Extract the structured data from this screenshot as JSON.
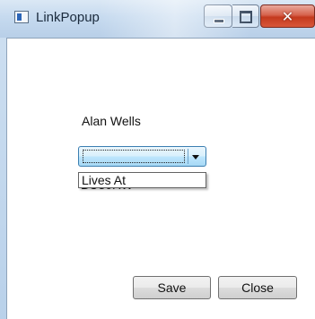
{
  "window": {
    "title": "LinkPopup",
    "icon": "app-window-icon",
    "controls": {
      "minimize_icon": "minimize-icon",
      "maximize_icon": "maximize-icon",
      "close_glyph": "✕"
    }
  },
  "content": {
    "person_name": "Alan Wells",
    "relationship_combo": {
      "selected_value": "",
      "options": [
        "Lives At"
      ]
    },
    "obscured_value": "BU30RW"
  },
  "buttons": {
    "save_label": "Save",
    "close_label": "Close"
  },
  "colors": {
    "titlebar": "#c6daef",
    "close_button": "#c43a1e",
    "combo_accent": "#3c7fb1"
  }
}
